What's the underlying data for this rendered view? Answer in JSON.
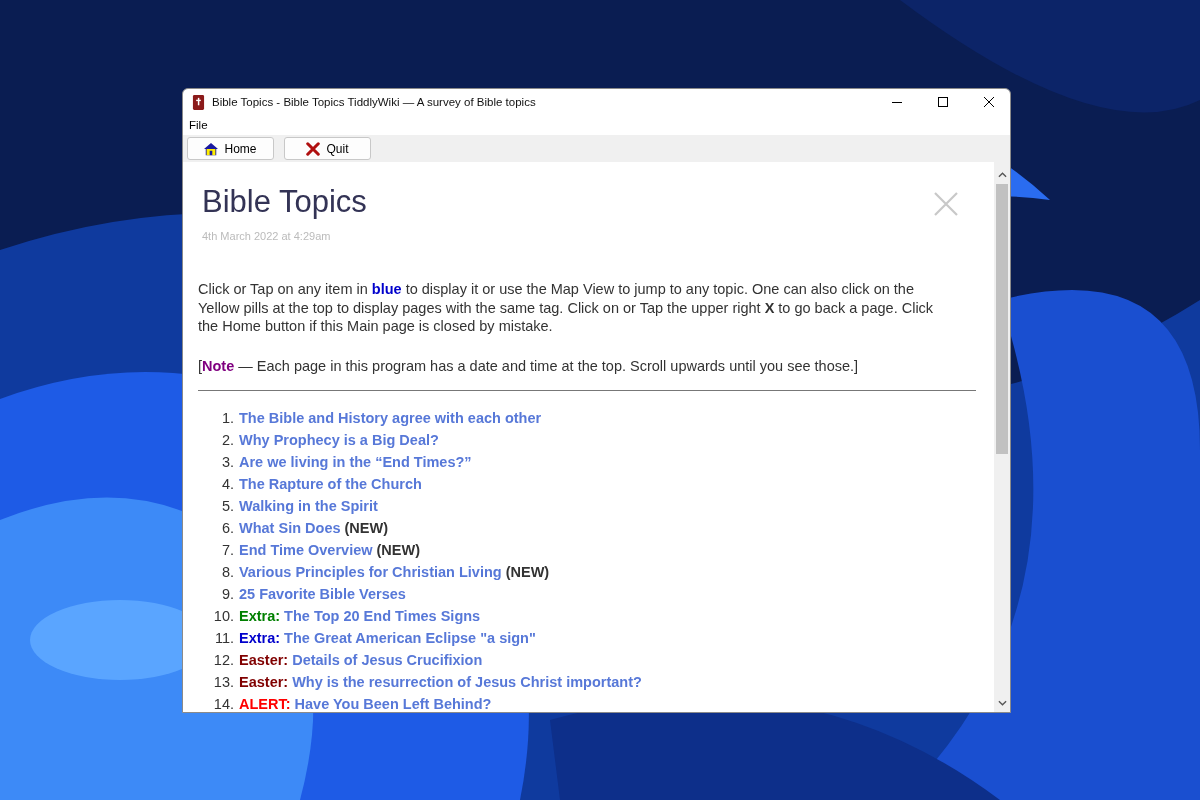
{
  "window": {
    "title": "Bible Topics - Bible Topics TiddlyWiki — A survey of Bible topics"
  },
  "menu": [
    "File"
  ],
  "toolbar": [
    {
      "label": "Home",
      "kind": "home"
    },
    {
      "label": "Quit",
      "kind": "quit"
    }
  ],
  "page": {
    "title": "Bible Topics",
    "date": "4th March 2022 at 4:29am",
    "intro": "Click or Tap on any item in **blue** to display it or use the Map View to jump to any topic. One can also click on the Yellow pills at the top to display pages with the same tag. Click on or Tap the upper right **X** to go back a page. Click the Home button if this Main page is closed by mistake.",
    "note": "[**Note** — Each page in this program has a date and time at the top. Scroll upwards until you see those.]"
  },
  "topics": [
    {
      "number": "1.",
      "title": "The Bible and History agree with each other"
    },
    {
      "number": "2.",
      "title": "Why Prophecy is a Big Deal?"
    },
    {
      "number": "3.",
      "title": "Are we living in the “End Times?”"
    },
    {
      "number": "4.",
      "title": "The Rapture of the Church"
    },
    {
      "number": "5.",
      "title": "Walking in the Spirit"
    },
    {
      "number": "6.",
      "title": "What Sin Does",
      "suffix": "(NEW)"
    },
    {
      "number": "7.",
      "title": "End Time Overview",
      "suffix": "(NEW)"
    },
    {
      "number": "8.",
      "title": "Various Principles for Christian Living",
      "suffix": "(NEW)"
    },
    {
      "number": "9.",
      "title": "25 Favorite Bible Verses"
    },
    {
      "number": "10.",
      "tag": "Extra:",
      "color": "#008000",
      "title": "The Top 20 End Times Signs"
    },
    {
      "number": "11.",
      "tag": "Extra:",
      "color": "#0000cc",
      "title": "The Great American Eclipse \"a sign\""
    },
    {
      "number": "12.",
      "tag": "Easter:",
      "color": "#800000",
      "title": "Details of Jesus Crucifixion"
    },
    {
      "number": "13.",
      "tag": "Easter:",
      "color": "#800000",
      "title": "Why is the resurrection of Jesus Christ important?"
    },
    {
      "number": "14.",
      "tag": "ALERT:",
      "color": "#ff0000",
      "title": "Have You Been Left Behind?"
    }
  ]
}
